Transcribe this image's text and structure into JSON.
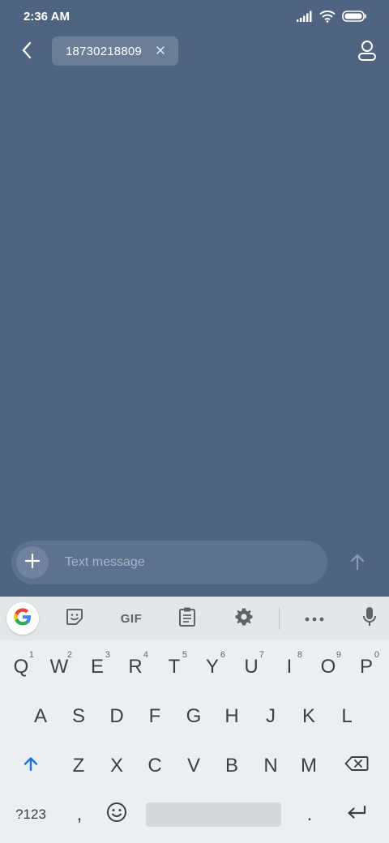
{
  "status_bar": {
    "time": "2:36 AM",
    "icons": [
      "signal-icon",
      "wifi-icon",
      "battery-icon"
    ]
  },
  "header": {
    "back_icon": "back-arrow-icon",
    "recipient": "18730218809",
    "chip_remove_icon": "close-icon",
    "contact_icon": "person-icon"
  },
  "composer": {
    "attach_icon": "plus-icon",
    "placeholder": "Text message",
    "value": "",
    "send_icon": "send-arrow-icon"
  },
  "keyboard": {
    "toolbar": {
      "items": [
        "google-icon",
        "sticker-icon",
        "gif-icon",
        "clipboard-icon",
        "gear-icon",
        "more-icon",
        "mic-icon"
      ],
      "gif_label": "GIF"
    },
    "row1": [
      {
        "label": "Q",
        "hint": "1"
      },
      {
        "label": "W",
        "hint": "2"
      },
      {
        "label": "E",
        "hint": "3"
      },
      {
        "label": "R",
        "hint": "4"
      },
      {
        "label": "T",
        "hint": "5"
      },
      {
        "label": "Y",
        "hint": "6"
      },
      {
        "label": "U",
        "hint": "7"
      },
      {
        "label": "I",
        "hint": "8"
      },
      {
        "label": "O",
        "hint": "9"
      },
      {
        "label": "P",
        "hint": "0"
      }
    ],
    "row2": [
      "A",
      "S",
      "D",
      "F",
      "G",
      "H",
      "J",
      "K",
      "L"
    ],
    "row3": [
      "Z",
      "X",
      "C",
      "V",
      "B",
      "N",
      "M"
    ],
    "row4": {
      "symbols_label": "?123",
      "comma_label": ",",
      "period_label": "."
    },
    "colors": {
      "accent": "#1a73e8",
      "key_text": "#3c4043",
      "background": "#eceff1"
    }
  },
  "colors": {
    "screen_background": "#4f6480",
    "chip_background": "#6b7e98",
    "composer_background": "#5d7190"
  }
}
